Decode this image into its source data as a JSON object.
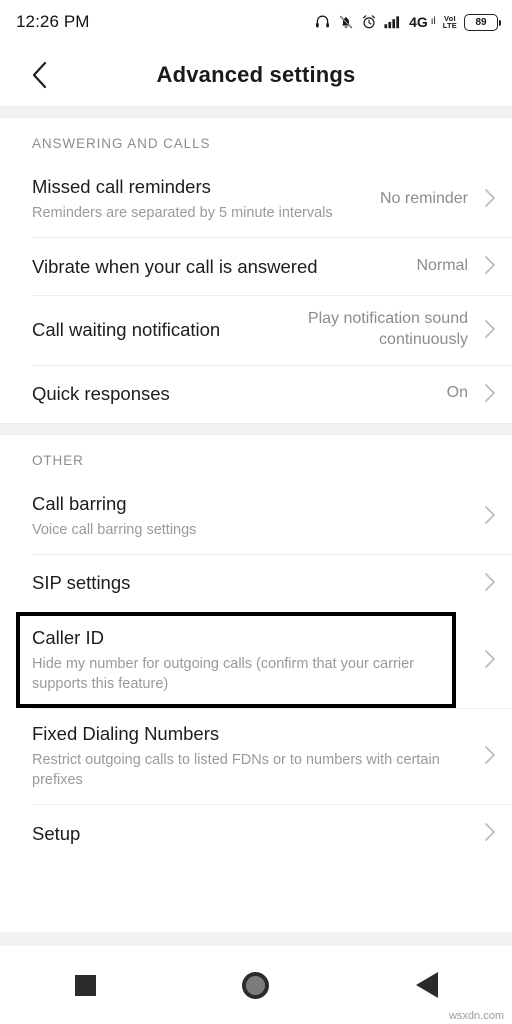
{
  "status_bar": {
    "time": "12:26 PM",
    "network_type": "4G",
    "network_suffix": "ıl",
    "volte_top": "VoI",
    "volte_bottom": "LTE",
    "battery_level": "89",
    "icons": [
      "headphones-icon",
      "mute-notifications-icon",
      "alarm-icon",
      "signal-bars-icon",
      "volte-icon",
      "battery-icon"
    ]
  },
  "app_bar": {
    "title": "Advanced settings",
    "back_label": "Back"
  },
  "sections": [
    {
      "header": "ANSWERING AND CALLS",
      "rows": [
        {
          "title": "Missed call reminders",
          "subtitle": "Reminders are separated by 5 minute intervals",
          "value": "No reminder",
          "highlighted": false
        },
        {
          "title": "Vibrate when your call is answered",
          "subtitle": "",
          "value": "Normal",
          "highlighted": false
        },
        {
          "title": "Call waiting notification",
          "subtitle": "",
          "value": "Play notification sound continuously",
          "highlighted": false
        },
        {
          "title": "Quick responses",
          "subtitle": "",
          "value": "On",
          "highlighted": false
        }
      ]
    },
    {
      "header": "OTHER",
      "rows": [
        {
          "title": "Call barring",
          "subtitle": "Voice call barring settings",
          "value": "",
          "highlighted": false
        },
        {
          "title": "SIP settings",
          "subtitle": "",
          "value": "",
          "highlighted": false
        },
        {
          "title": "Caller ID",
          "subtitle": "Hide my number for outgoing calls (confirm that your carrier supports this feature)",
          "value": "",
          "highlighted": true
        },
        {
          "title": "Fixed Dialing Numbers",
          "subtitle": "Restrict outgoing calls to listed FDNs or to numbers with certain prefixes",
          "value": "",
          "highlighted": false
        },
        {
          "title": "Setup",
          "subtitle": "",
          "value": "",
          "highlighted": false
        }
      ]
    }
  ],
  "nav_bar": {
    "recents_label": "Recents",
    "home_label": "Home",
    "back_label": "Back"
  },
  "watermark": "wsxdn.com",
  "colors": {
    "accent": "#000000",
    "title": "#1d1d1d",
    "secondary": "#9a9a9a",
    "background": "#ffffff"
  }
}
